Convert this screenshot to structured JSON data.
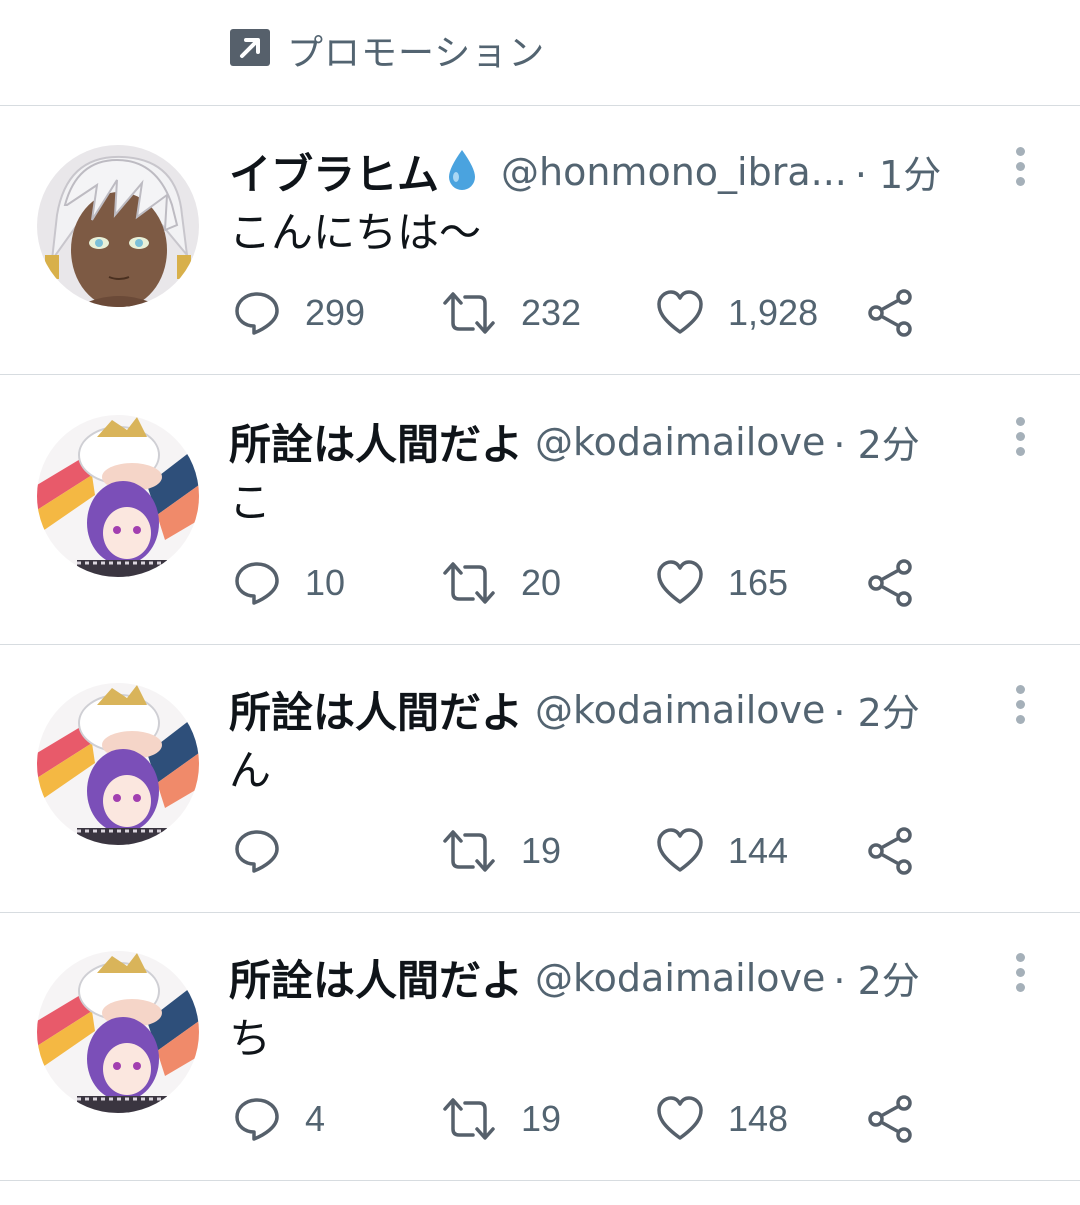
{
  "promotion": {
    "label": "プロモーション"
  },
  "tweets": [
    {
      "name": "イブラヒム",
      "verified_emoji": "droplet",
      "handle": "@honmono_ibra...",
      "time": "· 1分",
      "text": "こんにちは〜",
      "replies": "299",
      "retweets": "232",
      "likes": "1,928"
    },
    {
      "name": "所詮は人間だよ",
      "handle": "@kodaimailove",
      "time": "· 2分",
      "text": "こ",
      "replies": "10",
      "retweets": "20",
      "likes": "165"
    },
    {
      "name": "所詮は人間だよ",
      "handle": "@kodaimailove",
      "time": "· 2分",
      "text": "ん",
      "replies": "",
      "retweets": "19",
      "likes": "144"
    },
    {
      "name": "所詮は人間だよ",
      "handle": "@kodaimailove",
      "time": "· 2分",
      "text": "ち",
      "replies": "4",
      "retweets": "19",
      "likes": "148"
    }
  ],
  "colors": {
    "text_primary": "#0f1419",
    "text_secondary": "#536471",
    "divider": "#d7dce0",
    "verified_drop": "#4aa3df"
  },
  "icons": {
    "promo": "promoted-arrow-icon",
    "reply": "reply-icon",
    "retweet": "retweet-icon",
    "like": "heart-icon",
    "share": "share-icon",
    "more": "more-vertical-icon"
  }
}
